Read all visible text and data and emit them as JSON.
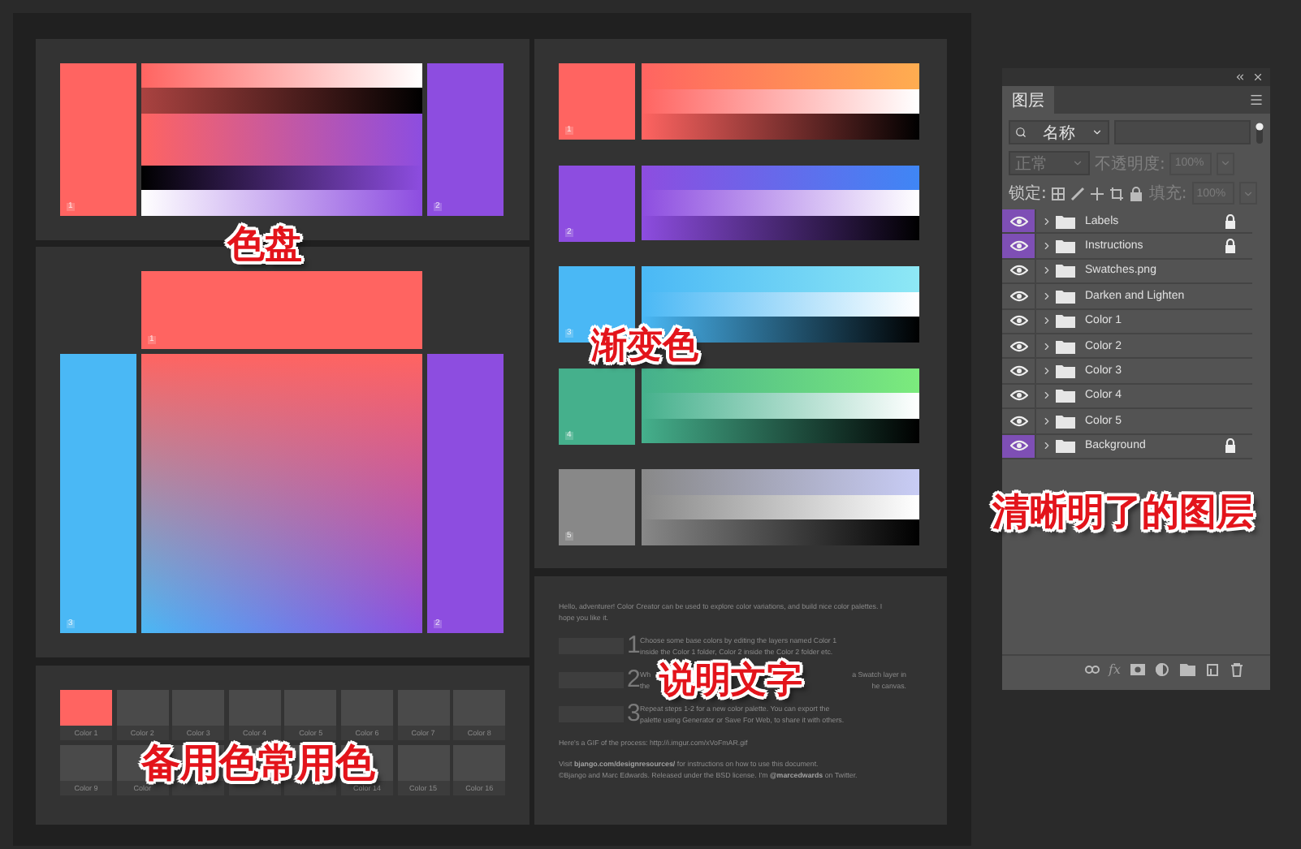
{
  "canvas": {
    "blend_panel": {
      "left": {
        "number": "1",
        "color": "#ff6461"
      },
      "right": {
        "number": "2",
        "color": "#8d4de0"
      }
    },
    "mixer_panel": {
      "top": {
        "number": "1",
        "color": "#ff6461"
      },
      "left": {
        "number": "3",
        "color": "#4ab8f5"
      },
      "right": {
        "number": "2",
        "color": "#8d4de0"
      }
    },
    "swatch_panel": {
      "swatches": [
        {
          "label": "Color 1",
          "color": "#ff6461"
        },
        {
          "label": "Color 2",
          "color": "#4a4a4a"
        },
        {
          "label": "Color 3",
          "color": "#4a4a4a"
        },
        {
          "label": "Color 4",
          "color": "#4a4a4a"
        },
        {
          "label": "Color 5",
          "color": "#4a4a4a"
        },
        {
          "label": "Color 6",
          "color": "#4a4a4a"
        },
        {
          "label": "Color 7",
          "color": "#4a4a4a"
        },
        {
          "label": "Color 8",
          "color": "#4a4a4a"
        },
        {
          "label": "Color 9",
          "color": "#4a4a4a"
        },
        {
          "label": "Color",
          "color": "#4a4a4a"
        },
        {
          "color": "#4a4a4a"
        },
        {
          "color": "#4a4a4a"
        },
        {
          "color": "#4a4a4a"
        },
        {
          "label": "Color 14",
          "color": "#4a4a4a"
        },
        {
          "label": "Color 15",
          "color": "#4a4a4a"
        },
        {
          "label": "Color 16",
          "color": "#4a4a4a"
        }
      ]
    },
    "gradient_panel": {
      "rows": [
        {
          "number": "1",
          "color": "#ff6461",
          "end": {
            "color": "#ffad50"
          }
        },
        {
          "number": "2",
          "color": "#8d4de0",
          "end": {
            "color": "#3f86f5"
          }
        },
        {
          "number": "3",
          "color": "#4ab8f5",
          "end": {
            "color": "#8ee8f5"
          }
        },
        {
          "number": "4",
          "color": "#45b08c",
          "end": {
            "color": "#7ceb7d"
          }
        },
        {
          "number": "5",
          "color": "#888888",
          "end": {
            "color": "#c8ccf5"
          }
        }
      ]
    },
    "instructions_panel": {
      "intro": "Hello, adventurer! Color Creator can be used to explore color variations, and build nice color palettes. I hope you like it.",
      "steps": [
        {
          "number": "1",
          "lines": [
            [
              "Choose some base colors by editing the layers named Color 1"
            ],
            [
              "inside the Color 1 folder, Color 2 inside the Color 2 folder etc."
            ]
          ]
        },
        {
          "number": "2",
          "lines": [
            [
              "Wh",
              "a Swatch layer in"
            ],
            [
              "the",
              "he canvas."
            ]
          ]
        },
        {
          "number": "3",
          "lines": [
            [
              "Repeat steps 1-2 for a new color palette. You can export the"
            ],
            [
              "palette using Generator or Save For Web, to share it with others."
            ]
          ]
        }
      ],
      "gif_line": "Here's a GIF of the process: http://i.imgur.com/xVoFmAR.gif",
      "visit_line": {
        "before": "Visit ",
        "link": "bjango.com/designresources/",
        "after": " for instructions on how to use this document."
      },
      "credit_line": {
        "before": "©Bjango and Marc Edwards. Released under the BSD license. I'm ",
        "link": "@marcedwards",
        "after": " on Twitter."
      }
    }
  },
  "layers_panel": {
    "tabs": [
      {
        "label": "图层",
        "selected": true
      }
    ],
    "filter": {
      "value": "名称"
    },
    "blend": {
      "value": "正常",
      "disabled": true
    },
    "opacity": {
      "label": "不透明度:",
      "value": "100%",
      "disabled": true
    },
    "lock": {
      "label": "锁定:"
    },
    "fill": {
      "label": "填充:",
      "value": "100%",
      "disabled": true
    },
    "layers": [
      {
        "name": "Labels",
        "visible": true,
        "locked": true,
        "color": "#7e4fb5"
      },
      {
        "name": "Instructions",
        "visible": true,
        "locked": true,
        "color": "#7e4fb5"
      },
      {
        "name": "Swatches.png",
        "visible": true,
        "locked": false
      },
      {
        "name": "Darken and Lighten",
        "visible": true,
        "locked": false
      },
      {
        "name": "Color 1",
        "visible": true,
        "locked": false
      },
      {
        "name": "Color 2",
        "visible": true,
        "locked": false
      },
      {
        "name": "Color 3",
        "visible": true,
        "locked": false
      },
      {
        "name": "Color 4",
        "visible": true,
        "locked": false
      },
      {
        "name": "Color 5",
        "visible": true,
        "locked": false
      },
      {
        "name": "Background",
        "visible": true,
        "locked": true,
        "color": "#7e4fb5"
      }
    ],
    "footer_tools": [
      {
        "kind": "link"
      },
      {
        "kind": "fx",
        "label": "fx"
      },
      {
        "kind": "mask"
      },
      {
        "kind": "adjustment"
      },
      {
        "kind": "folder"
      },
      {
        "kind": "new"
      },
      {
        "kind": "trash"
      }
    ]
  },
  "annotations": [
    {
      "text": "色盘"
    },
    {
      "text": "渐变色"
    },
    {
      "text": "备用色常用色"
    },
    {
      "text": "说明文字"
    },
    {
      "text": "清晰明了的图层"
    }
  ]
}
